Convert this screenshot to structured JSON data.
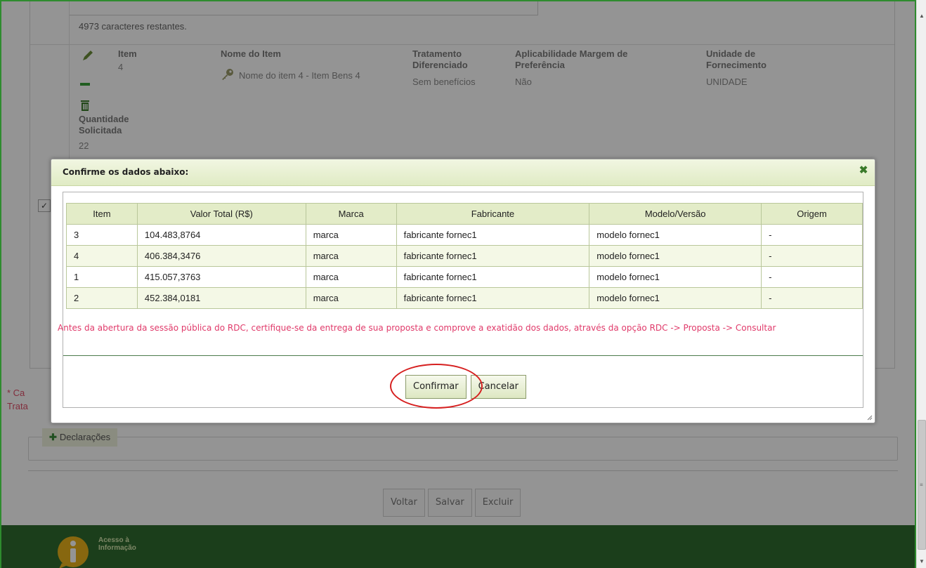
{
  "background": {
    "chars_remaining": "4973 caracteres restantes.",
    "labels": {
      "item": "Item",
      "nome_item": "Nome do Item",
      "tratamento": "Tratamento Diferenciado",
      "aplicabilidade": "Aplicabilidade Margem de Preferência",
      "unidade": "Unidade de Fornecimento",
      "quantidade": "Quantidade Solicitada"
    },
    "values": {
      "item": "4",
      "nome_item": "Nome do item 4 - Item Bens 4",
      "tratamento": "Sem benefícios",
      "aplicabilidade": "Não",
      "unidade": "UNIDADE",
      "quantidade": "22"
    },
    "note_line1": "* Ca",
    "note_line2": "Trata",
    "declaracoes_label": "Declarações",
    "buttons": {
      "voltar": "Voltar",
      "salvar": "Salvar",
      "excluir": "Excluir"
    },
    "footer": {
      "acesso_line1": "Acesso à",
      "acesso_line2": "Informação"
    }
  },
  "dialog": {
    "title": "Confirme os dados abaixo:",
    "close_icon": "close-icon",
    "columns": [
      "Item",
      "Valor Total (R$)",
      "Marca",
      "Fabricante",
      "Modelo/Versão",
      "Origem"
    ],
    "rows": [
      [
        "3",
        "104.483,8764",
        "marca",
        "fabricante fornec1",
        "modelo fornec1",
        "-"
      ],
      [
        "4",
        "406.384,3476",
        "marca",
        "fabricante fornec1",
        "modelo fornec1",
        "-"
      ],
      [
        "1",
        "415.057,3763",
        "marca",
        "fabricante fornec1",
        "modelo fornec1",
        "-"
      ],
      [
        "2",
        "452.384,0181",
        "marca",
        "fabricante fornec1",
        "modelo fornec1",
        "-"
      ]
    ],
    "warning": "Antes da abertura da sessão pública do RDC, certifique-se da entrega de sua proposta e comprove a exatidão dos dados, através da opção RDC -> Proposta -> Consultar",
    "confirm_label": "Confirmar",
    "cancel_label": "Cancelar"
  },
  "colors": {
    "accent_green": "#2f6b2f",
    "header_green": "#e0ebc4",
    "warning_pink": "#e03a6a",
    "highlight_red": "#d62020"
  }
}
